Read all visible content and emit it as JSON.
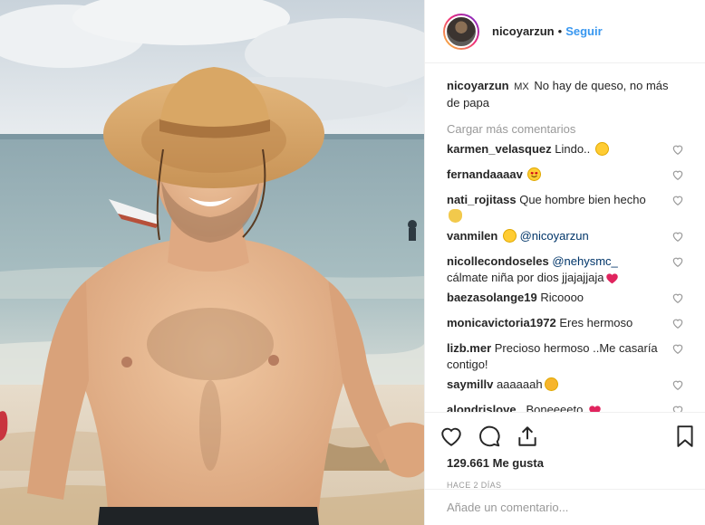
{
  "post": {
    "username": "nicoyarzun",
    "separator": "•",
    "follow_label": "Seguir",
    "caption_flag": "MX",
    "caption_text": "No hay de queso, no más de papa",
    "load_more": "Cargar más comentarios",
    "likes_count": "129.661",
    "likes_label": "Me gusta",
    "time_ago": "HACE 2 DÍAS",
    "add_comment_placeholder": "Añade un comentario..."
  },
  "comments": [
    {
      "user": "karmen_velasquez",
      "text": "Lindo..",
      "emoji": "yellow-face-emoji"
    },
    {
      "user": "fernandaaaav",
      "text": "",
      "emoji": "heart-eyes-emoji"
    },
    {
      "user": "nati_rojitass",
      "text": "Que hombre bien hecho",
      "emoji": "ok-hand-emoji"
    },
    {
      "user": "vanmilen",
      "text": "",
      "emoji": "smile-emoji",
      "mention": "@nicoyarzun"
    },
    {
      "user": "nicollecondoseles",
      "mention": "@nehysmc_",
      "text": "cálmate niña por dios jjajajjaja",
      "emoji": "red-heart-emoji"
    },
    {
      "user": "baezasolange19",
      "text": "Ricoooo"
    },
    {
      "user": "monicavictoria1972",
      "text": "Eres hermoso"
    },
    {
      "user": "lizb.mer",
      "text": "Precioso hermoso ..Me casaría contigo!"
    },
    {
      "user": "saymillv",
      "text": "aaaaaah",
      "emoji": "heart-eyes-cat-emoji"
    },
    {
      "user": "alondrislove_",
      "text": "Boneeeeto",
      "emoji": "red-heart-emoji"
    }
  ],
  "colors": {
    "follow_blue": "#3897f0",
    "secondary_gray": "#999999",
    "border": "#efefef",
    "text": "#262626"
  }
}
